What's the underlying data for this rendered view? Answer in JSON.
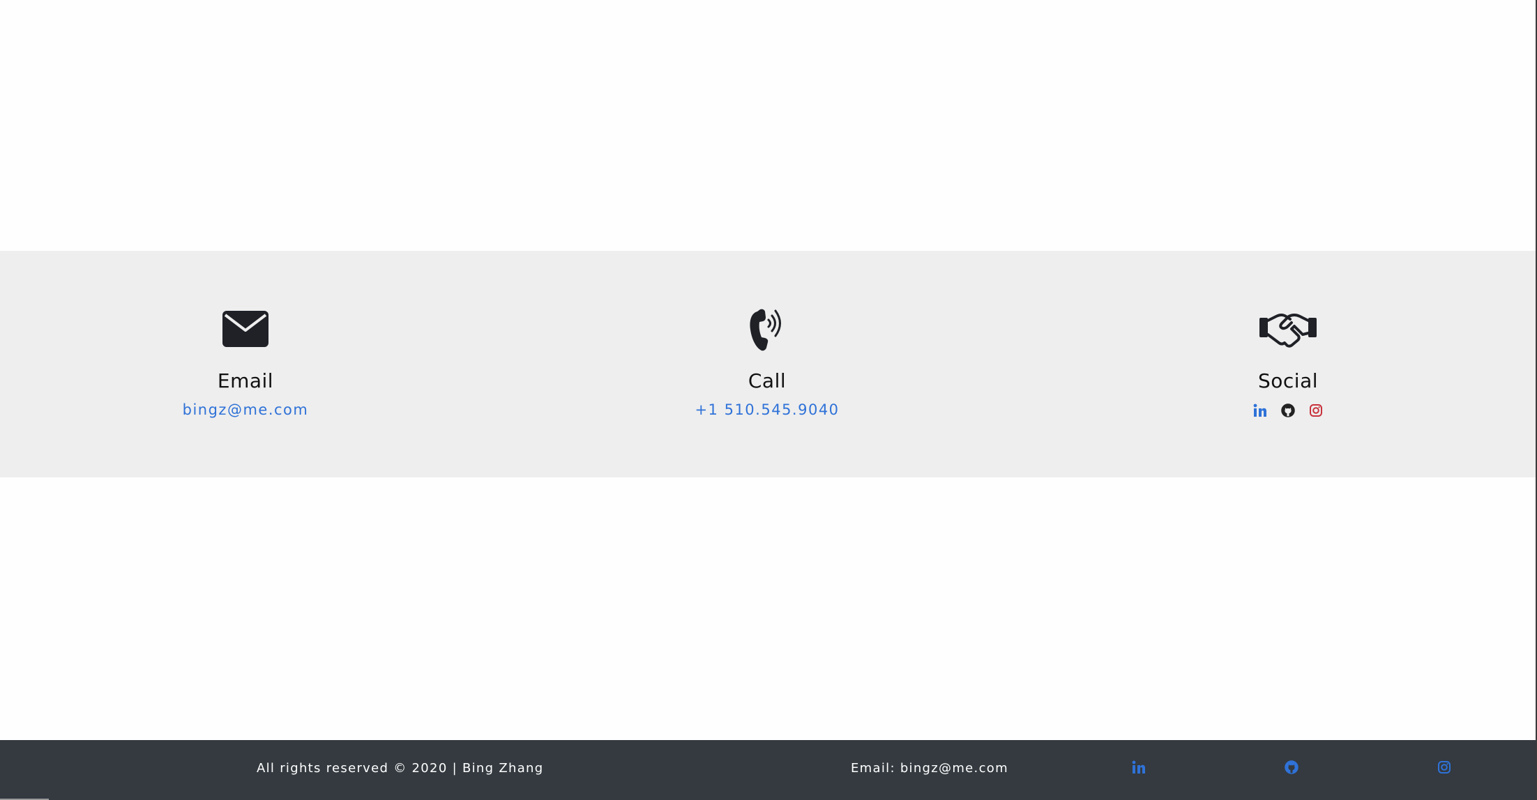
{
  "contact": {
    "email": {
      "icon": "envelope-icon",
      "title": "Email",
      "value": "bingz@me.com"
    },
    "call": {
      "icon": "phone-icon",
      "title": "Call",
      "value": "+1 510.545.9040"
    },
    "social": {
      "icon": "handshake-icon",
      "title": "Social",
      "links": [
        {
          "icon": "linkedin-icon",
          "color": "#2f72d8"
        },
        {
          "icon": "github-icon",
          "color": "#222222"
        },
        {
          "icon": "instagram-icon",
          "color": "#c8323c"
        }
      ]
    }
  },
  "footer": {
    "copyright": "All rights reserved © 2020 | Bing Zhang",
    "email": "Email: bingz@me.com",
    "links": [
      {
        "icon": "linkedin-icon"
      },
      {
        "icon": "github-icon"
      },
      {
        "icon": "instagram-icon"
      }
    ],
    "icon_color": "#2f72d8"
  },
  "colors": {
    "band_background": "#eeeeee",
    "footer_background": "#343a40",
    "link": "#2f72d8"
  }
}
